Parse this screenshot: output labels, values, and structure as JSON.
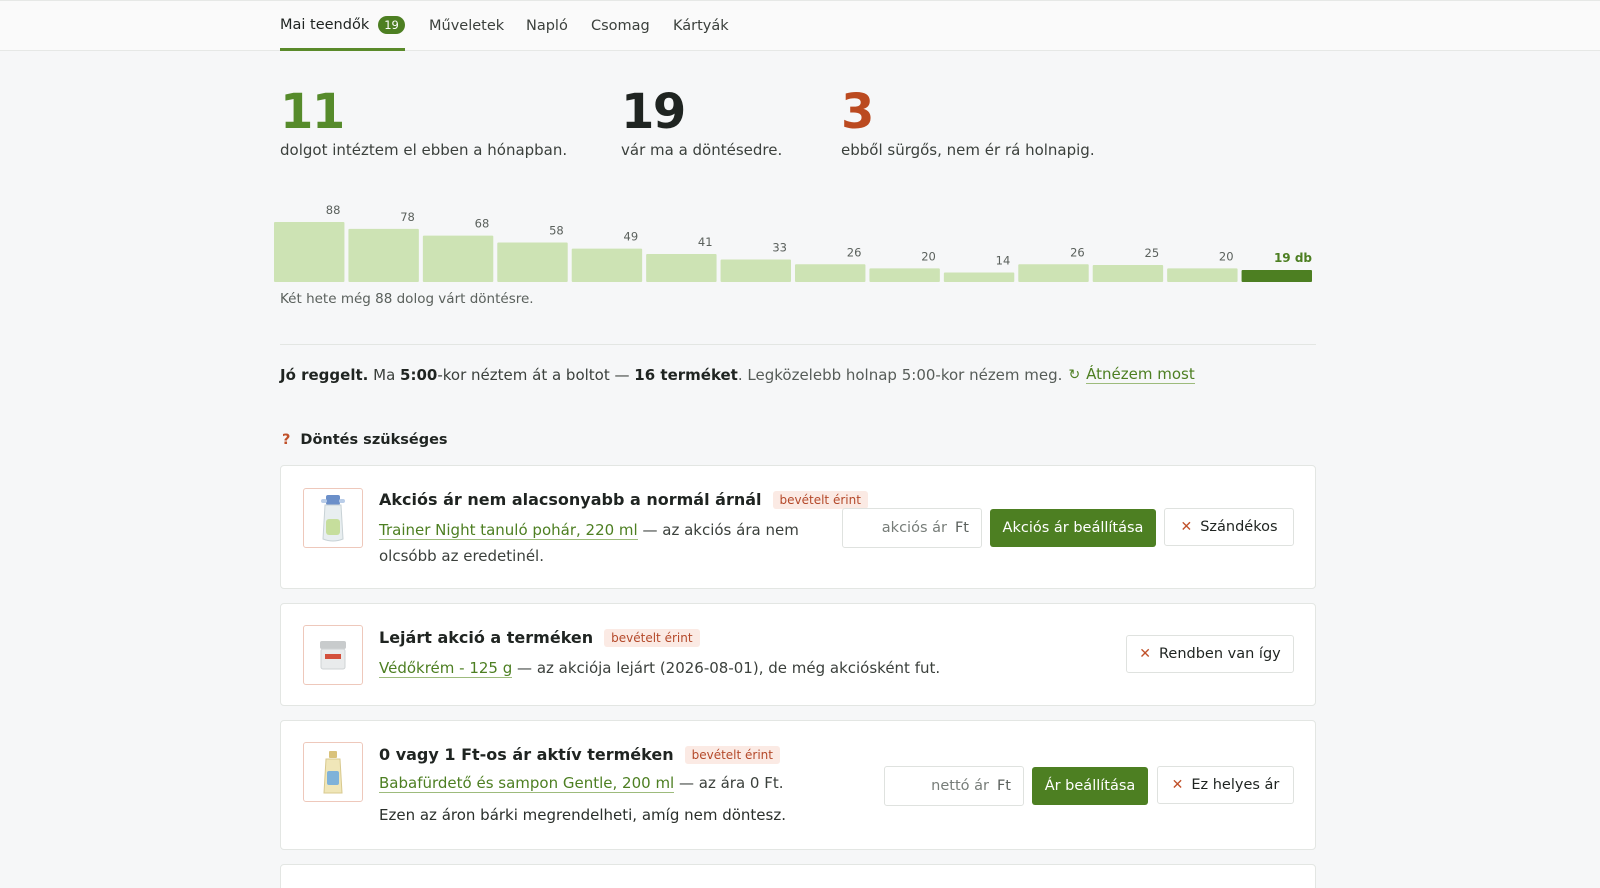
{
  "nav": {
    "tabs": [
      {
        "label": "Mai teendők",
        "badge": "19"
      },
      {
        "label": "Műveletek"
      },
      {
        "label": "Napló"
      },
      {
        "label": "Csomag"
      },
      {
        "label": "Kártyák"
      }
    ]
  },
  "stats": [
    {
      "value": "11",
      "label": "dolgot intéztem el ebben a hónapban."
    },
    {
      "value": "19",
      "label": "vár ma a döntésedre."
    },
    {
      "value": "3",
      "label": "ebből sürgős, nem ér rá holnapig."
    }
  ],
  "chart_data": {
    "type": "bar",
    "values": [
      88,
      78,
      68,
      58,
      49,
      41,
      33,
      26,
      20,
      14,
      26,
      25,
      20,
      19
    ],
    "value_labels": [
      "88",
      "78",
      "68",
      "58",
      "49",
      "41",
      "33",
      "26",
      "20",
      "14",
      "26",
      "25",
      "20",
      "19 db"
    ],
    "highlight_last": true,
    "colors": {
      "bar": "#cde3b4",
      "highlight": "#4d7f22",
      "label": "#5b615d",
      "highlight_label": "#4d7f22"
    },
    "caption": "Két hete még 88 dolog várt döntésre."
  },
  "status": {
    "greeting": "Jó reggelt.",
    "t1": "Ma",
    "time": "5:00",
    "t2": "-kor néztem át a boltot —",
    "count": "16 terméket",
    "t3": ". Legközelebb holnap 5:00-kor nézem meg.",
    "refresh_icon": "refresh-icon",
    "refresh_label": "Átnézem most"
  },
  "section": {
    "icon": "?",
    "title": "Döntés szükséges"
  },
  "cards": [
    {
      "title": "Akciós ár nem alacsonyabb a normál árnál",
      "tag": "bevételt érint",
      "product": "Trainer Night tanuló pohár, 220 ml",
      "desc": "— az akciós ára nem",
      "desc2": "olcsóbb az eredetinél.",
      "input_placeholder": "akciós ár",
      "unit": "Ft",
      "primary": "Akciós ár beállítása",
      "secondary": "Szándékos"
    },
    {
      "title": "Lejárt akció a terméken",
      "tag": "bevételt érint",
      "product": "Védőkrém - 125 g",
      "desc": "— az akciója lejárt (2026-08-01), de még akciósként fut.",
      "secondary": "Rendben van így"
    },
    {
      "title": "0 vagy 1 Ft-os ár aktív terméken",
      "tag": "bevételt érint",
      "product": "Babafürdető és sampon Gentle, 200 ml",
      "desc": "— az ára 0 Ft.",
      "extra": "Ezen az áron bárki megrendelheti, amíg nem döntesz.",
      "input_placeholder": "nettó ár",
      "unit": "Ft",
      "primary": "Ár beállítása",
      "secondary": "Ez helyes ár"
    }
  ]
}
